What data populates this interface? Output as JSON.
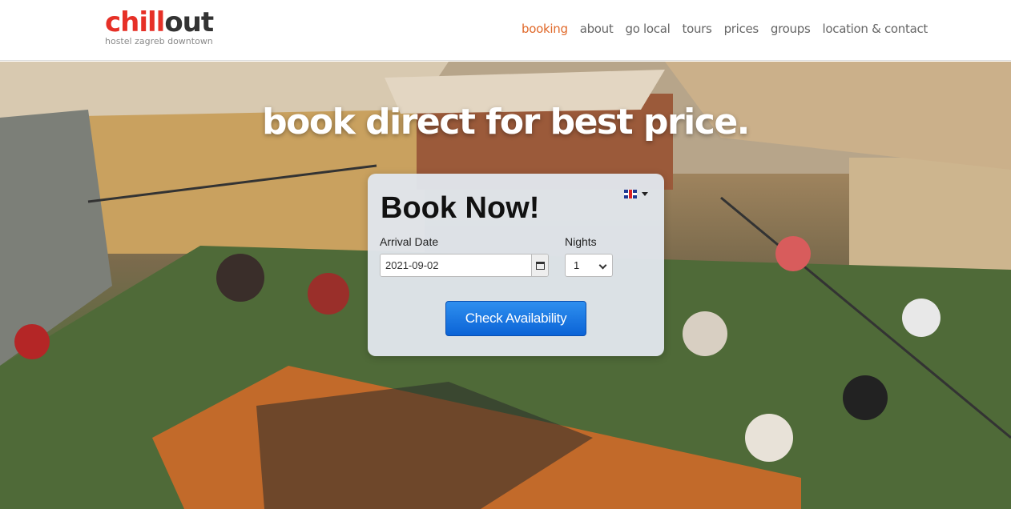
{
  "header": {
    "logo": {
      "main_part1": "chi",
      "main_mark": "ll",
      "main_part2": "out",
      "subtitle": "hostel zagreb downtown"
    },
    "nav": [
      "booking",
      "about",
      "go local",
      "tours",
      "prices",
      "groups",
      "location & contact"
    ],
    "active_nav": "booking"
  },
  "hero": {
    "title": "book direct for best price."
  },
  "booking": {
    "title": "Book Now!",
    "language_icon": "uk-flag-icon",
    "arrival_label": "Arrival Date",
    "arrival_value": "2021-09-02",
    "nights_label": "Nights",
    "nights_value": "1",
    "check_button": "Check Availability"
  },
  "colors": {
    "brand_red": "#e63027",
    "nav_active": "#e0692a",
    "button_blue": "#0b63d6"
  }
}
